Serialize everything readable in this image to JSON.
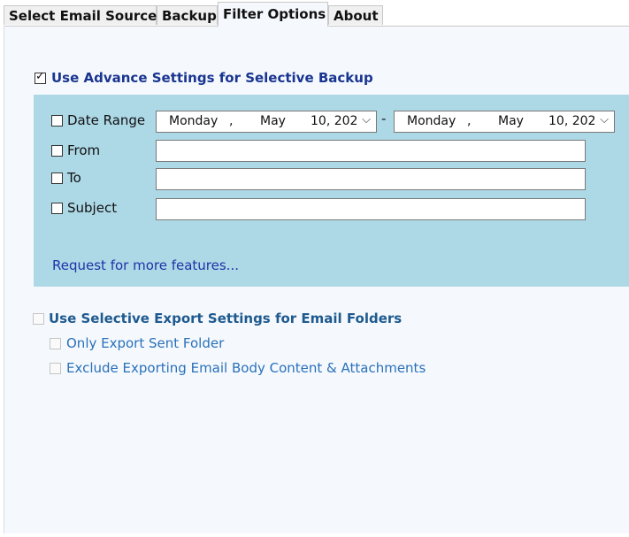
{
  "tabs": [
    {
      "label": "Select Email Source",
      "active": false
    },
    {
      "label": "Backup",
      "active": false
    },
    {
      "label": "Filter Options",
      "active": true
    },
    {
      "label": "About",
      "active": false
    }
  ],
  "advance": {
    "label": "Use Advance Settings for Selective Backup",
    "checked": true
  },
  "filters": {
    "date_range": {
      "label": "Date Range",
      "separator": "-",
      "start": {
        "weekday": "Monday",
        "comma": ",",
        "month": "May",
        "day_year": "10, 202"
      },
      "end": {
        "weekday": "Monday",
        "comma": ",",
        "month": "May",
        "day_year": "10, 202"
      }
    },
    "from": {
      "label": "From",
      "value": ""
    },
    "to": {
      "label": "To",
      "value": ""
    },
    "subject": {
      "label": "Subject",
      "value": ""
    },
    "request_link": "Request for more features..."
  },
  "selective_export": {
    "label": "Use Selective Export Settings for Email Folders",
    "options": [
      {
        "label": "Only Export Sent Folder"
      },
      {
        "label": "Exclude Exporting Email Body Content & Attachments"
      }
    ]
  },
  "colors": {
    "panel_bg": "#f5f9fe",
    "filter_box_bg": "#add8e6",
    "link": "#1f33a8",
    "advance_label": "#1a3590"
  }
}
